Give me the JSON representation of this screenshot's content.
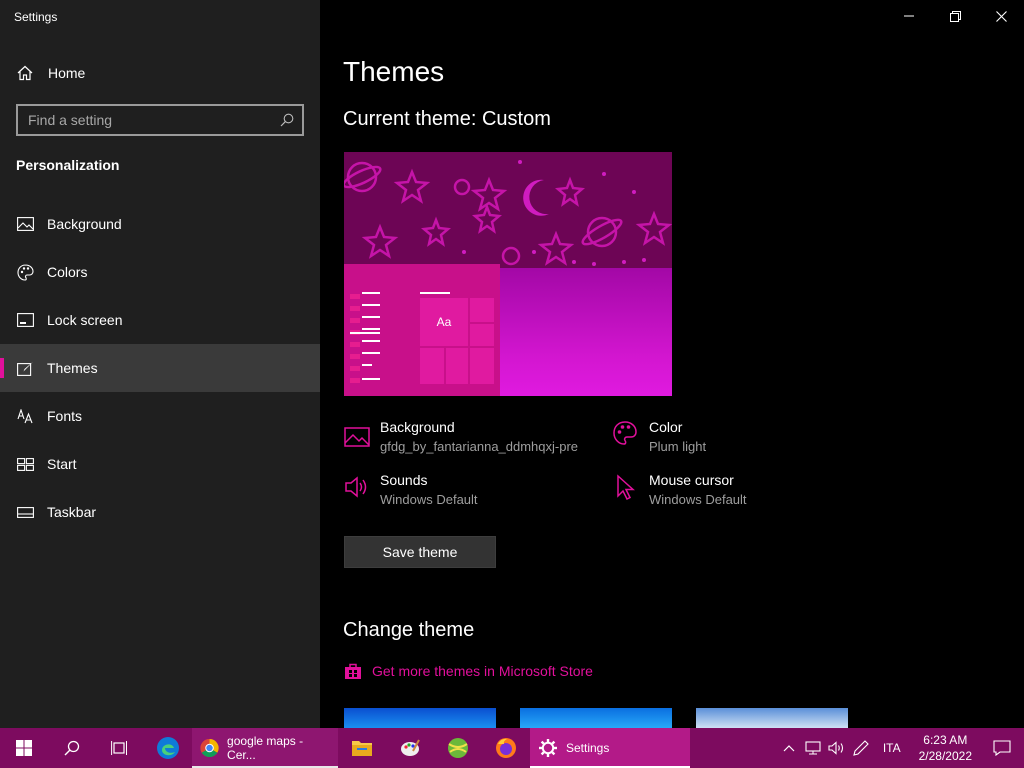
{
  "window": {
    "title": "Settings"
  },
  "sidebar": {
    "home_label": "Home",
    "search_placeholder": "Find a setting",
    "section_title": "Personalization",
    "items": [
      {
        "label": "Background",
        "icon": "picture-icon"
      },
      {
        "label": "Colors",
        "icon": "palette-icon"
      },
      {
        "label": "Lock screen",
        "icon": "lock-screen-icon"
      },
      {
        "label": "Themes",
        "icon": "themes-brush-icon",
        "selected": true
      },
      {
        "label": "Fonts",
        "icon": "fonts-icon"
      },
      {
        "label": "Start",
        "icon": "start-icon"
      },
      {
        "label": "Taskbar",
        "icon": "taskbar-icon"
      }
    ]
  },
  "main": {
    "title": "Themes",
    "current_theme": "Current theme: Custom",
    "preview_sample": "Aa",
    "details": {
      "background": {
        "label": "Background",
        "value": "gfdg_by_fantarianna_ddmhqxj-pre"
      },
      "color": {
        "label": "Color",
        "value": "Plum light"
      },
      "sounds": {
        "label": "Sounds",
        "value": "Windows Default"
      },
      "mouse": {
        "label": "Mouse cursor",
        "value": "Windows Default"
      }
    },
    "save_button": "Save theme",
    "change_title": "Change theme",
    "store_link": "Get more themes in Microsoft Store"
  },
  "taskbar": {
    "apps": [
      {
        "label": "google maps - Cer...",
        "icon": "chrome-icon"
      },
      {
        "label": "Settings",
        "icon": "gear-icon"
      }
    ],
    "language": "ITA",
    "time": "6:23 AM",
    "date": "2/28/2022"
  },
  "colors": {
    "accent": "#e1109b",
    "taskbar": "#7d0b5f",
    "sidebar": "#1f1f1f"
  }
}
